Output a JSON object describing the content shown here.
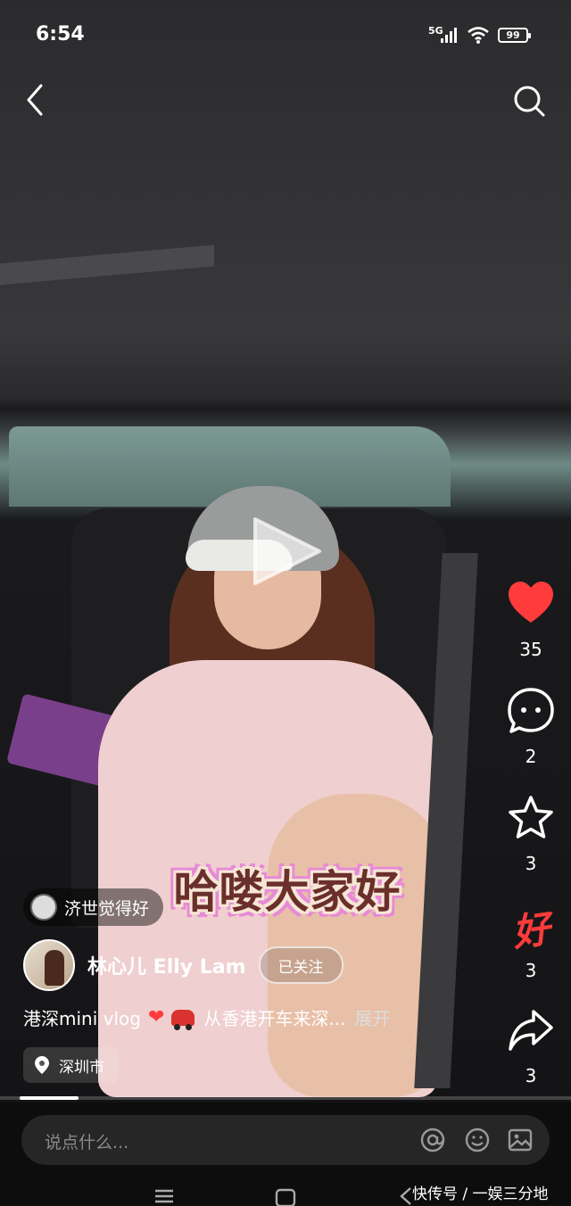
{
  "status_bar": {
    "time": "6:54",
    "network": "5G",
    "battery": "99"
  },
  "video": {
    "overlay_caption": "哈喽大家好",
    "progress": 0.11
  },
  "actions": {
    "like_count": "35",
    "comment_count": "2",
    "collect_count": "3",
    "good_count": "3",
    "good_label": "好",
    "share_count": "3"
  },
  "referral": {
    "text": "济世觉得好"
  },
  "author": {
    "name": "林心儿 Elly Lam",
    "follow_label": "已关注"
  },
  "description": {
    "text_prefix": "港深mini vlog",
    "text_suffix": "从香港开车来深...",
    "more_label": "展开"
  },
  "location": {
    "label": "深圳市"
  },
  "comment": {
    "placeholder": "说点什么..."
  },
  "watermark": "快传号 / 一娱三分地",
  "colors": {
    "like": "#ff3b3b",
    "good": "#ff3b3b",
    "caption_text": "#6a2f2a"
  }
}
